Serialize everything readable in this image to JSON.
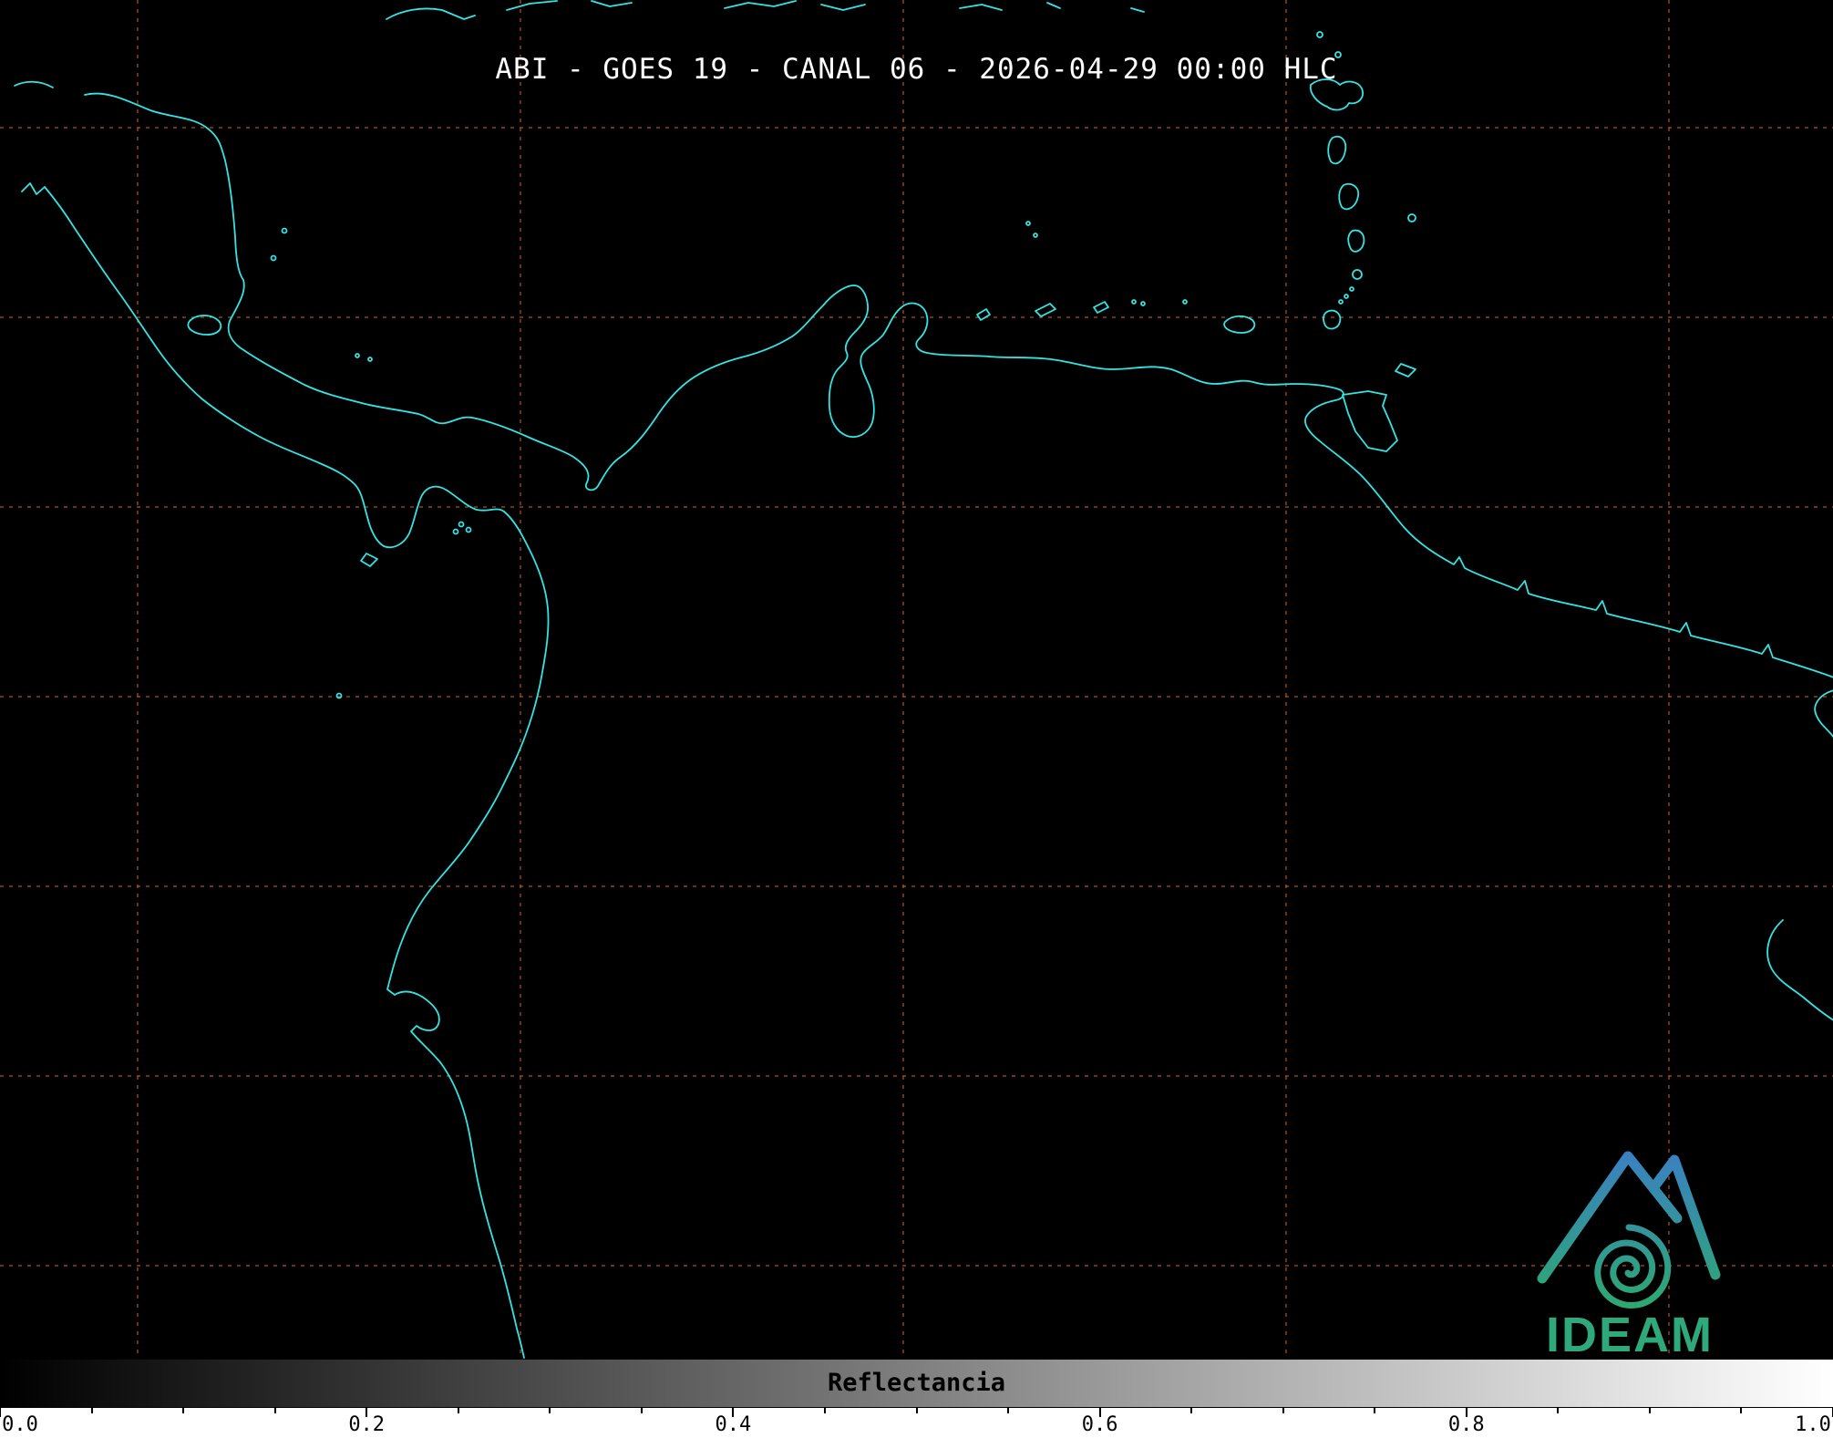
{
  "header": {
    "title": "ABI - GOES 19 - CANAL 06 - 2026-04-29 00:00 HLC"
  },
  "map": {
    "background_color": "#000000",
    "coastline_color": "#33e4e4",
    "grid_color": "#bc5a1b"
  },
  "colorbar": {
    "label": "Reflectancia",
    "ticks": [
      {
        "label": "0.0",
        "fraction": 0.0
      },
      {
        "label": "0.2",
        "fraction": 0.2
      },
      {
        "label": "0.4",
        "fraction": 0.4
      },
      {
        "label": "0.6",
        "fraction": 0.6
      },
      {
        "label": "0.8",
        "fraction": 0.8
      },
      {
        "label": "1.0",
        "fraction": 1.0
      }
    ],
    "gradient_start_color": "#000000",
    "gradient_end_color": "#ffffff"
  },
  "logo": {
    "text": "IDEAM",
    "text_color": "#2ea97b",
    "gradient_top_color": "#3b7fc4",
    "gradient_bottom_color": "#2caa6e"
  }
}
